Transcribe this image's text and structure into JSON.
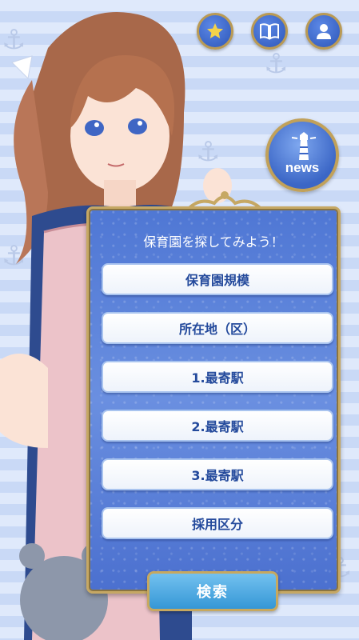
{
  "header": {
    "favorites_icon": "star-icon",
    "guide_icon": "book-icon",
    "profile_icon": "user-icon"
  },
  "news": {
    "label": "news",
    "icon": "lighthouse-icon"
  },
  "search_panel": {
    "title": "保育園を探してみよう！",
    "options": [
      {
        "label": "保育園規模"
      },
      {
        "label": "所在地（区）"
      },
      {
        "label": "1.最寄駅"
      },
      {
        "label": "2.最寄駅"
      },
      {
        "label": "3.最寄駅"
      },
      {
        "label": "採用区分"
      }
    ],
    "submit_label": "検索"
  },
  "colors": {
    "accent_blue": "#3b66c6",
    "gold_border": "#c6a864",
    "button_text": "#244a9c"
  }
}
